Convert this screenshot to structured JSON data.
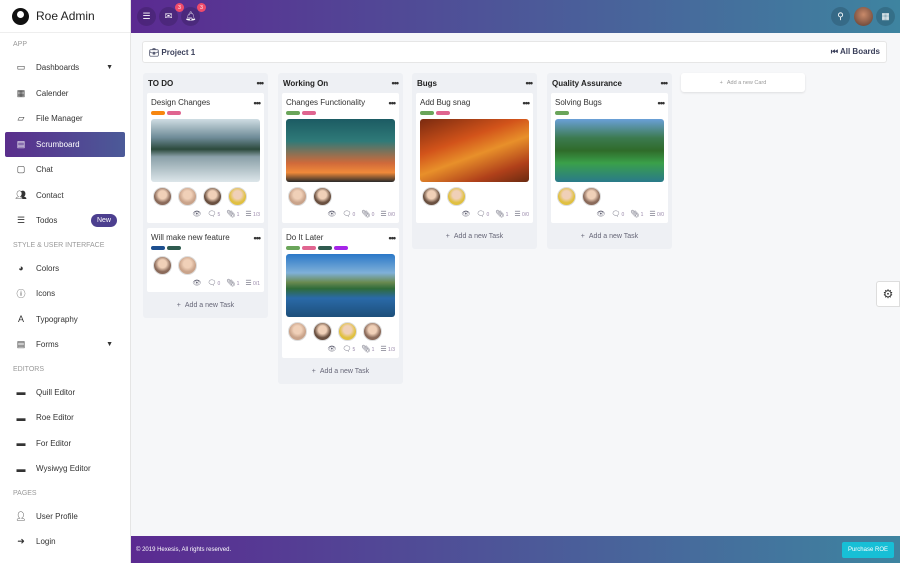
{
  "app": {
    "title": "Roe Admin"
  },
  "sidebar": {
    "sections": [
      {
        "label": "APP",
        "items": [
          {
            "label": "Dashboards",
            "icon": "monitor-icon",
            "caret": true
          },
          {
            "label": "Calender",
            "icon": "calendar-icon"
          },
          {
            "label": "File Manager",
            "icon": "folder-icon"
          },
          {
            "label": "Scrumboard",
            "icon": "clipboard-icon",
            "active": true
          },
          {
            "label": "Chat",
            "icon": "chat-icon"
          },
          {
            "label": "Contact",
            "icon": "contacts-icon"
          },
          {
            "label": "Todos",
            "icon": "list-icon",
            "badge": "New"
          }
        ]
      },
      {
        "label": "STYLE & USER INTERFACE",
        "items": [
          {
            "label": "Colors",
            "icon": "palette-icon"
          },
          {
            "label": "Icons",
            "icon": "info-icon"
          },
          {
            "label": "Typography",
            "icon": "font-icon"
          },
          {
            "label": "Forms",
            "icon": "form-icon",
            "caret": true
          }
        ]
      },
      {
        "label": "EDITORS",
        "items": [
          {
            "label": "Quill Editor",
            "icon": "editor-icon"
          },
          {
            "label": "Roe Editor",
            "icon": "editor-icon"
          },
          {
            "label": "For Editor",
            "icon": "editor-icon"
          },
          {
            "label": "Wysiwyg Editor",
            "icon": "editor-icon"
          }
        ]
      },
      {
        "label": "PAGES",
        "items": [
          {
            "label": "User Profile",
            "icon": "user-icon"
          },
          {
            "label": "Login",
            "icon": "login-icon"
          }
        ]
      }
    ]
  },
  "topbar": {
    "mail_count": "3",
    "notif_count": "3"
  },
  "board": {
    "project": "Project 1",
    "all_boards": "All Boards",
    "add_card": "Add a new Card",
    "add_task": "Add a new Task",
    "columns": [
      {
        "title": "TO DO",
        "cards": [
          {
            "title": "Design Changes",
            "tags": [
              "#f7860f",
              "#e06590"
            ],
            "image": "lake",
            "avatars": 4,
            "comments": "5",
            "attachments": "1",
            "checklist": "1/3"
          },
          {
            "title": "Will make new feature",
            "tags": [
              "#1d4f8f",
              "#2f5b4f"
            ],
            "image": null,
            "avatars": 2,
            "comments": "0",
            "attachments": "1",
            "checklist": "0/1"
          }
        ]
      },
      {
        "title": "Working On",
        "cards": [
          {
            "title": "Changes Functionality",
            "tags": [
              "#6aa55a",
              "#e06590"
            ],
            "image": "sunset",
            "avatars": 2,
            "comments": "0",
            "attachments": "0",
            "checklist": "0/0"
          },
          {
            "title": "Do It Later",
            "tags": [
              "#6aa55a",
              "#e06590",
              "#2f5b4f",
              "#a525e8"
            ],
            "image": "mountain",
            "avatars": 4,
            "comments": "5",
            "attachments": "1",
            "checklist": "1/3"
          }
        ]
      },
      {
        "title": "Bugs",
        "cards": [
          {
            "title": "Add Bug snag",
            "tags": [
              "#6aa55a",
              "#e06590"
            ],
            "image": "autumn",
            "avatars": 2,
            "comments": "0",
            "attachments": "1",
            "checklist": "0/0"
          }
        ]
      },
      {
        "title": "Quality Assurance",
        "cards": [
          {
            "title": "Solving Bugs",
            "tags": [
              "#6aa55a"
            ],
            "image": "green",
            "avatars": 2,
            "comments": "0",
            "attachments": "1",
            "checklist": "0/0"
          }
        ]
      }
    ]
  },
  "footer": {
    "copyright": "© 2019 Hexesis, All rights reserved.",
    "purchase": "Purchase ROE"
  }
}
